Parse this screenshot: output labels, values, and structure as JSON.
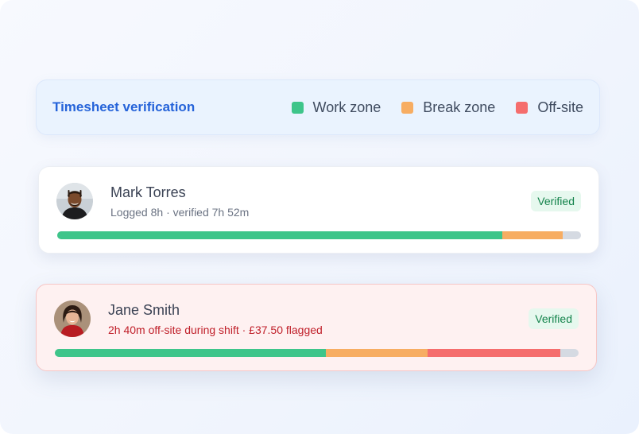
{
  "colors": {
    "work": "#3ec58a",
    "break": "#f7ad62",
    "offsite": "#f56d6d",
    "remaining": "#d5dae2",
    "title_blue": "#2563d9",
    "flag_red": "#c0202a",
    "verified_green": "#14834b"
  },
  "legend": {
    "title": "Timesheet verification",
    "items": [
      {
        "label": "Work zone",
        "color": "#3ec58a"
      },
      {
        "label": "Break zone",
        "color": "#f7ad62"
      },
      {
        "label": "Off-site",
        "color": "#f56d6d"
      }
    ]
  },
  "employees": [
    {
      "name": "Mark Torres",
      "summary": "Logged 8h · verified 7h 52m",
      "status": "Verified",
      "avatar_icon": "person-avatar-icon",
      "segments": [
        {
          "zone": "work",
          "fraction": 0.85
        },
        {
          "zone": "break",
          "fraction": 0.115
        }
      ]
    },
    {
      "name": "Jane Smith",
      "summary": "2h 40m off-site during shift · £37.50 flagged",
      "status": "Verified",
      "avatar_icon": "person-avatar-icon",
      "segments": [
        {
          "zone": "work",
          "fraction": 0.518
        },
        {
          "zone": "break",
          "fraction": 0.193
        },
        {
          "zone": "offsite",
          "fraction": 0.254
        }
      ]
    }
  ]
}
